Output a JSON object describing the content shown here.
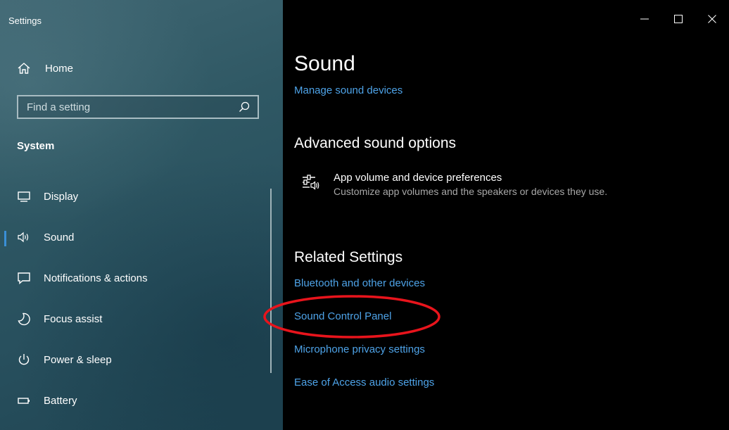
{
  "window": {
    "title": "Settings",
    "controls": {
      "minimize_icon": "minimize-icon",
      "maximize_icon": "maximize-icon",
      "close_icon": "close-icon"
    }
  },
  "sidebar": {
    "home_label": "Home",
    "search_placeholder": "Find a setting",
    "section_title": "System",
    "items": [
      {
        "label": "Display",
        "icon": "display-icon",
        "selected": false
      },
      {
        "label": "Sound",
        "icon": "speaker-icon",
        "selected": true
      },
      {
        "label": "Notifications & actions",
        "icon": "notifications-icon",
        "selected": false
      },
      {
        "label": "Focus assist",
        "icon": "moon-icon",
        "selected": false
      },
      {
        "label": "Power & sleep",
        "icon": "power-icon",
        "selected": false
      },
      {
        "label": "Battery",
        "icon": "battery-icon",
        "selected": false
      }
    ]
  },
  "main": {
    "title": "Sound",
    "manage_link": "Manage sound devices",
    "advanced": {
      "heading": "Advanced sound options",
      "item_title": "App volume and device preferences",
      "item_desc": "Customize app volumes and the speakers or devices they use."
    },
    "related": {
      "heading": "Related Settings",
      "links": [
        "Bluetooth and other devices",
        "Sound Control Panel",
        "Microphone privacy settings",
        "Ease of Access audio settings"
      ]
    }
  },
  "colors": {
    "accent_link": "#4ea3e8",
    "selection_bar": "#3a8fd6",
    "annotation_circle": "#e8141c"
  }
}
